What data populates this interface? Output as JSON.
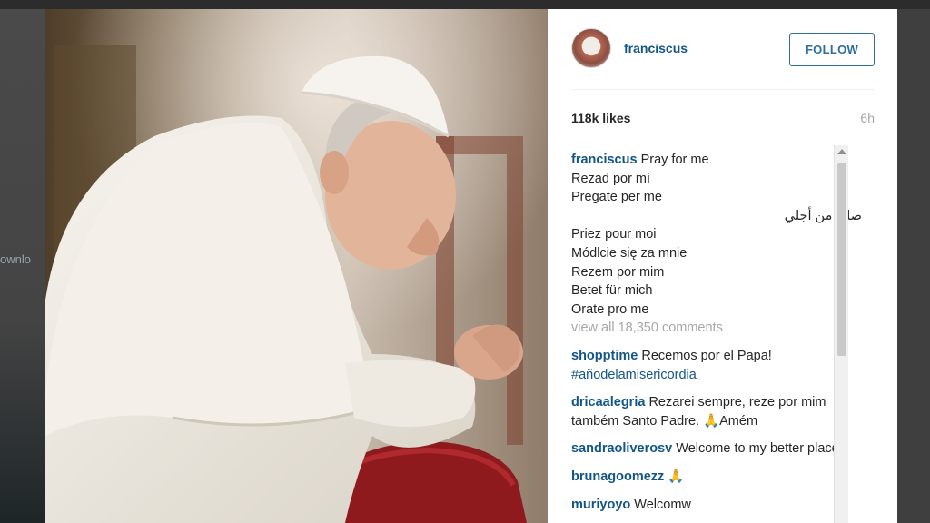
{
  "post": {
    "username": "franciscus",
    "follow_label": "FOLLOW",
    "likes": "118k likes",
    "time_ago": "6h",
    "caption_lines": [
      "Pray for me",
      "Rezad por mí",
      "Pregate per me",
      "صلوا من أجلي",
      "Priez pour moi",
      "Módlcie się za mnie",
      "Rezem por mim",
      "Betet für mich",
      "Orate pro me"
    ],
    "view_all": "view all 18,350 comments"
  },
  "comments": [
    {
      "user": "shopptime",
      "text": "Recemos por el Papa!",
      "hashtag": "#añodelamisericordia"
    },
    {
      "user": "dricaalegria",
      "text": "Rezarei sempre, reze por mim também Santo Padre. 🙏Amém"
    },
    {
      "user": "sandraoliverosv",
      "text": "Welcome to my better place!"
    },
    {
      "user": "brunagoomezz",
      "text": "🙏"
    },
    {
      "user": "muriyoyo",
      "text": "Welcomw"
    }
  ],
  "background": {
    "left_fragment": "ownlo"
  },
  "colors": {
    "link_blue": "#125688",
    "follow_blue": "#2f6ea0",
    "muted_gray": "#a5a7aa"
  }
}
